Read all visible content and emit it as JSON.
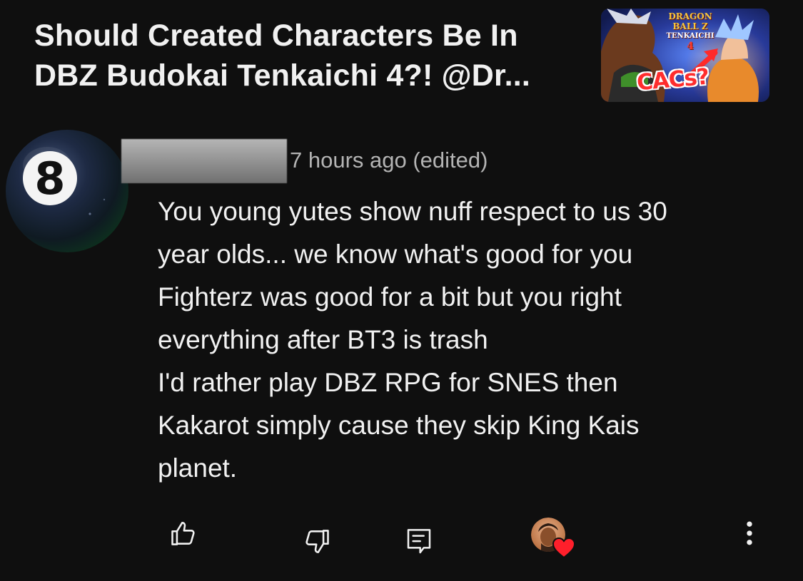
{
  "video": {
    "title_line_1": "Should Created Characters Be In",
    "title_line_2": "DBZ Budokai Tenkaichi 4?! @Dr...",
    "thumbnail": {
      "logo_text_1": "DRAGON BALL Z",
      "logo_text_2": "TENKAICHI",
      "logo_text_3": "4",
      "badge_text": "CACs?"
    }
  },
  "comment": {
    "avatar_icon": "eight-ball-icon",
    "timestamp": "7 hours ago (edited)",
    "lines": [
      "You young yutes show nuff respect to us 30",
      "year olds... we know what's good for you",
      "Fighterz was good for a bit but you right",
      "everything after BT3 is trash",
      "I'd rather play DBZ RPG for SNES then",
      "Kakarot simply cause they skip King Kais",
      "planet."
    ]
  },
  "actions": {
    "like_icon": "thumbs-up-icon",
    "dislike_icon": "thumbs-down-icon",
    "reply_icon": "reply-icon",
    "creator_heart_icon": "heart-icon",
    "more_icon": "more-vertical-icon"
  },
  "colors": {
    "background": "#0f0f0f",
    "text_primary": "#f1f1f1",
    "text_secondary": "#b4b4b4",
    "heart": "#ff1f2b"
  }
}
